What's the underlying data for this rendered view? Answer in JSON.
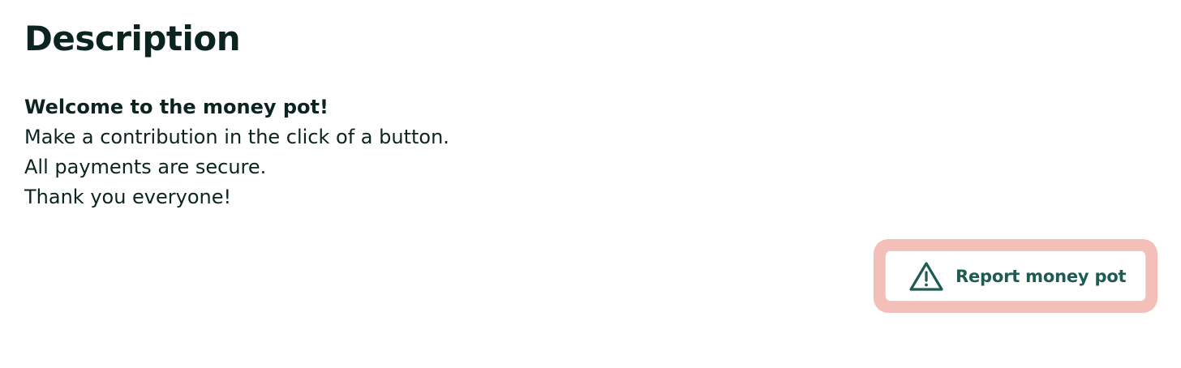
{
  "description": {
    "title": "Description",
    "lines": [
      "Welcome to the money pot!",
      "Make a contribution in the click of a button.",
      "All payments are secure.",
      "Thank you everyone!"
    ]
  },
  "report": {
    "label": "Report money pot",
    "icon": "warning-triangle-icon"
  },
  "colors": {
    "text": "#0b2420",
    "accent": "#1e5b53",
    "focus_ring": "#f4bfb8"
  }
}
